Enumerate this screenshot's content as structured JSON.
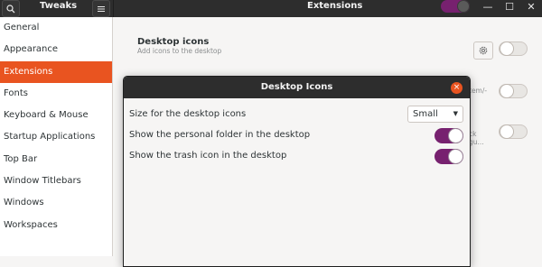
{
  "header": {
    "app_title": "Tweaks",
    "page_title": "Extensions",
    "search_icon": "search-icon",
    "menu_icon": "hamburger-menu-icon",
    "global_switch_on": true,
    "window_controls": {
      "minimize_glyph": "—",
      "maximize_glyph": "☐",
      "close_glyph": "✕"
    }
  },
  "sidebar": {
    "items": [
      {
        "label": "General"
      },
      {
        "label": "Appearance"
      },
      {
        "label": "Extensions",
        "active": true
      },
      {
        "label": "Fonts"
      },
      {
        "label": "Keyboard & Mouse"
      },
      {
        "label": "Startup Applications"
      },
      {
        "label": "Top Bar"
      },
      {
        "label": "Window Titlebars"
      },
      {
        "label": "Windows"
      },
      {
        "label": "Workspaces"
      }
    ]
  },
  "main": {
    "extension": {
      "title": "Desktop icons",
      "description": "Add icons to the desktop",
      "settings_icon": "gear-icon",
      "enabled": false
    },
    "partial_texts": [
      "tem/-",
      "ck",
      "gu..."
    ]
  },
  "dialog": {
    "title": "Desktop Icons",
    "close_glyph": "×",
    "rows": [
      {
        "label": "Size for the desktop icons",
        "value": "Small"
      },
      {
        "label": "Show the personal folder in the desktop",
        "on": true
      },
      {
        "label": "Show the trash icon in the desktop",
        "on": true
      }
    ]
  },
  "colors": {
    "accent_orange": "#e95420",
    "toggle_purple": "#77216f",
    "headerbar_dark": "#2d2d2d"
  }
}
